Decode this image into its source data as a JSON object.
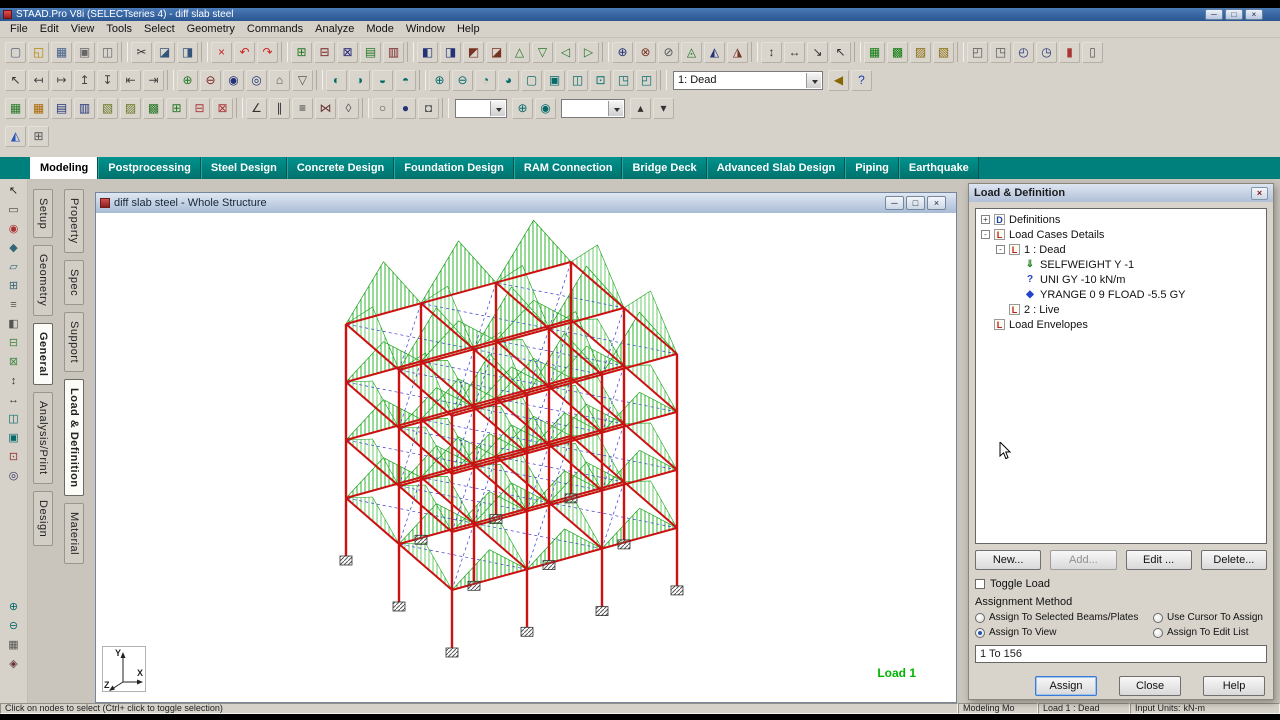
{
  "titlebar": {
    "title": "STAAD.Pro V8i (SELECTseries 4) - diff slab steel",
    "window_buttons": [
      {
        "g": "─"
      },
      {
        "g": "□"
      },
      {
        "g": "×"
      }
    ]
  },
  "menubar": [
    "File",
    "Edit",
    "View",
    "Tools",
    "Select",
    "Geometry",
    "Commands",
    "Analyze",
    "Mode",
    "Window",
    "Help"
  ],
  "toolbars": {
    "load_case_value": "1: Dead",
    "combo2_value": "",
    "combo3_value": "",
    "row1": [
      {
        "g": "▢",
        "c": "#55667a"
      },
      {
        "g": "◱",
        "c": "#b8860b"
      },
      {
        "g": "▦",
        "c": "#445e8c"
      },
      {
        "g": "▣",
        "c": "#666666"
      },
      {
        "g": "◫",
        "c": "#666666"
      },
      {
        "sep": true
      },
      {
        "g": "✂",
        "c": "#333333"
      },
      {
        "g": "◪",
        "c": "#33557a"
      },
      {
        "g": "◨",
        "c": "#33557a"
      },
      {
        "sep": true
      },
      {
        "g": "×",
        "c": "#cc2222"
      },
      {
        "g": "↶",
        "c": "#cc2222"
      },
      {
        "g": "↷",
        "c": "#cc2222"
      },
      {
        "sep": true
      },
      {
        "g": "⊞",
        "c": "#227722"
      },
      {
        "g": "⊟",
        "c": "#772222"
      },
      {
        "g": "⊠",
        "c": "#222277"
      },
      {
        "g": "▤",
        "c": "#227722"
      },
      {
        "g": "▥",
        "c": "#772222"
      },
      {
        "sep": true
      },
      {
        "g": "◧",
        "c": "#223377"
      },
      {
        "g": "◨",
        "c": "#223377"
      },
      {
        "g": "◩",
        "c": "#773322"
      },
      {
        "g": "◪",
        "c": "#773322"
      },
      {
        "g": "△",
        "c": "#227722"
      },
      {
        "g": "▽",
        "c": "#227722"
      },
      {
        "g": "◁",
        "c": "#227722"
      },
      {
        "g": "▷",
        "c": "#227722"
      },
      {
        "sep": true
      },
      {
        "g": "⊕",
        "c": "#223377"
      },
      {
        "g": "⊗",
        "c": "#773322"
      },
      {
        "g": "⊘",
        "c": "#555555"
      },
      {
        "g": "◬",
        "c": "#227722"
      },
      {
        "g": "◭",
        "c": "#223377"
      },
      {
        "g": "◮",
        "c": "#773322"
      },
      {
        "sep": true
      },
      {
        "g": "↕",
        "c": "#333333"
      },
      {
        "g": "↔",
        "c": "#333333"
      },
      {
        "g": "↘",
        "c": "#333333"
      },
      {
        "g": "↖",
        "c": "#333333"
      },
      {
        "sep": true
      },
      {
        "g": "▦",
        "c": "#0a7a0a"
      },
      {
        "g": "▩",
        "c": "#0a7a0a"
      },
      {
        "g": "▨",
        "c": "#8a6a0a"
      },
      {
        "g": "▧",
        "c": "#8a6a0a"
      },
      {
        "sep": true
      },
      {
        "g": "◰",
        "c": "#555555"
      },
      {
        "g": "◳",
        "c": "#555555"
      },
      {
        "g": "◴",
        "c": "#223377"
      },
      {
        "g": "◷",
        "c": "#223377"
      },
      {
        "g": "▮",
        "c": "#aa3333"
      },
      {
        "g": "▯",
        "c": "#555555"
      }
    ],
    "row2a": [
      {
        "g": "↖",
        "c": "#333333"
      },
      {
        "g": "↤",
        "c": "#444444"
      },
      {
        "g": "↦",
        "c": "#444444"
      },
      {
        "g": "↥",
        "c": "#444444"
      },
      {
        "g": "↧",
        "c": "#444444"
      },
      {
        "g": "⇤",
        "c": "#444444"
      },
      {
        "g": "⇥",
        "c": "#444444"
      },
      {
        "sep": true
      },
      {
        "g": "⊕",
        "c": "#227722"
      },
      {
        "g": "⊖",
        "c": "#772222"
      },
      {
        "g": "◉",
        "c": "#223377"
      },
      {
        "g": "◎",
        "c": "#223377"
      },
      {
        "g": "⌂",
        "c": "#555555"
      },
      {
        "g": "▽",
        "c": "#555555"
      },
      {
        "sep": true
      },
      {
        "g": "◐",
        "c": "#066a6a"
      },
      {
        "g": "◑",
        "c": "#066a6a"
      },
      {
        "g": "◒",
        "c": "#066a6a"
      },
      {
        "g": "◓",
        "c": "#066a6a"
      },
      {
        "sep": true
      },
      {
        "g": "⊕",
        "c": "#066a6a"
      },
      {
        "g": "⊖",
        "c": "#066a6a"
      },
      {
        "g": "◔",
        "c": "#066a6a"
      },
      {
        "g": "◕",
        "c": "#066a6a"
      },
      {
        "g": "▢",
        "c": "#066a6a"
      },
      {
        "g": "▣",
        "c": "#066a6a"
      },
      {
        "g": "◫",
        "c": "#066a6a"
      },
      {
        "g": "⊡",
        "c": "#066a6a"
      },
      {
        "g": "◳",
        "c": "#066a6a"
      },
      {
        "g": "◰",
        "c": "#066a6a"
      },
      {
        "sep": true
      }
    ],
    "row2b": [
      {
        "g": "◀",
        "c": "#886600"
      },
      {
        "g": "?",
        "c": "#1a3fae"
      }
    ],
    "row3a": [
      {
        "g": "▦",
        "c": "#227722"
      },
      {
        "g": "▦",
        "c": "#aa6600"
      },
      {
        "g": "▤",
        "c": "#223377"
      },
      {
        "g": "▥",
        "c": "#223377"
      },
      {
        "g": "▧",
        "c": "#667722"
      },
      {
        "g": "▨",
        "c": "#667722"
      },
      {
        "g": "▩",
        "c": "#227722"
      },
      {
        "g": "⊞",
        "c": "#227722"
      },
      {
        "g": "⊟",
        "c": "#aa3333"
      },
      {
        "g": "⊠",
        "c": "#aa3333"
      },
      {
        "sep": true
      },
      {
        "g": "∠",
        "c": "#333333"
      },
      {
        "g": "∥",
        "c": "#333333"
      },
      {
        "g": "≡",
        "c": "#333333"
      },
      {
        "g": "⋈",
        "c": "#663333"
      },
      {
        "g": "◊",
        "c": "#555555"
      },
      {
        "sep": true
      },
      {
        "g": "○",
        "c": "#555555"
      },
      {
        "g": "●",
        "c": "#223377"
      },
      {
        "g": "◘",
        "c": "#555555"
      },
      {
        "sep": true
      }
    ],
    "row3b": [
      {
        "g": "⊕",
        "c": "#066a6a"
      },
      {
        "g": "◉",
        "c": "#066a6a"
      }
    ],
    "row3c": [
      {
        "g": "▴",
        "c": "#333333"
      },
      {
        "g": "▾",
        "c": "#333333"
      }
    ],
    "row4": [
      {
        "g": "◭",
        "c": "#2255bb"
      },
      {
        "g": "⊞",
        "c": "#555555"
      }
    ]
  },
  "mode_tabs": [
    {
      "label": "Modeling",
      "active": true
    },
    {
      "label": "Postprocessing"
    },
    {
      "label": "Steel Design"
    },
    {
      "label": "Concrete Design"
    },
    {
      "label": "Foundation Design"
    },
    {
      "label": "RAM Connection"
    },
    {
      "label": "Bridge Deck"
    },
    {
      "label": "Advanced Slab Design"
    },
    {
      "label": "Piping"
    },
    {
      "label": "Earthquake"
    }
  ],
  "left_strip": {
    "top": [
      {
        "g": "↖",
        "c": "#222222"
      },
      {
        "g": "▭",
        "c": "#444444"
      },
      {
        "g": "◉",
        "c": "#aa3333"
      },
      {
        "g": "◆",
        "c": "#336677"
      },
      {
        "g": "▱",
        "c": "#336677"
      },
      {
        "g": "⊞",
        "c": "#336677"
      },
      {
        "g": "≡",
        "c": "#555555"
      },
      {
        "g": "◧",
        "c": "#555555"
      },
      {
        "g": "⊟",
        "c": "#448844"
      },
      {
        "g": "⊠",
        "c": "#448844"
      },
      {
        "g": "↕",
        "c": "#333333"
      },
      {
        "g": "↔",
        "c": "#333333"
      },
      {
        "g": "◫",
        "c": "#066a6a"
      },
      {
        "g": "▣",
        "c": "#066a6a"
      },
      {
        "g": "⊡",
        "c": "#993333"
      },
      {
        "g": "◎",
        "c": "#333366"
      }
    ],
    "bottom": [
      {
        "g": "⊕",
        "c": "#066a6a"
      },
      {
        "g": "⊖",
        "c": "#066a6a"
      },
      {
        "g": "▦",
        "c": "#555555"
      },
      {
        "g": "◈",
        "c": "#663333"
      }
    ]
  },
  "side_tabs": {
    "col1": [
      {
        "label": "Setup"
      },
      {
        "label": "Geometry"
      },
      {
        "label": "General",
        "active": true
      },
      {
        "label": "Analysis/Print"
      },
      {
        "label": "Design"
      }
    ],
    "col2": [
      {
        "label": "Property"
      },
      {
        "label": "Spec"
      },
      {
        "label": "Support"
      },
      {
        "label": "Load & Definition",
        "active": true
      },
      {
        "label": "Material"
      }
    ]
  },
  "model": {
    "window_title": "diff slab steel - Whole Structure",
    "window_buttons": [
      {
        "g": "─"
      },
      {
        "g": "□"
      },
      {
        "g": "×"
      }
    ],
    "load_label": "Load 1",
    "axis": {
      "x": "X",
      "y": "Y",
      "z": "Z"
    }
  },
  "dialog": {
    "title": "Load & Definition",
    "close_glyph": "×",
    "tree": [
      {
        "indent": 0,
        "expand": "+",
        "icon": "D",
        "icon_color": "#1a3fae",
        "cls": "boxed",
        "label": "Definitions"
      },
      {
        "indent": 0,
        "expand": "-",
        "icon": "L",
        "icon_color": "#c02020",
        "cls": "boxed",
        "label": "Load Cases Details"
      },
      {
        "indent": 1,
        "expand": "-",
        "icon": "L",
        "icon_color": "#c02020",
        "cls": "boxed",
        "label": "1 : Dead"
      },
      {
        "indent": 2,
        "expand": "",
        "icon": "⇓",
        "icon_color": "#1e7e1e",
        "label": "SELFWEIGHT Y -1"
      },
      {
        "indent": 2,
        "expand": "",
        "icon": "?",
        "icon_color": "#2244cc",
        "label": "UNI GY -10 kN/m"
      },
      {
        "indent": 2,
        "expand": "",
        "icon": "◆",
        "icon_color": "#2244cc",
        "label": "YRANGE 0 9 FLOAD -5.5 GY"
      },
      {
        "indent": 1,
        "expand": "",
        "icon": "L",
        "icon_color": "#c02020",
        "cls": "boxed",
        "label": "2 : Live"
      },
      {
        "indent": 0,
        "expand": "",
        "icon": "L",
        "icon_color": "#c02020",
        "cls": "boxed",
        "label": "Load Envelopes"
      }
    ],
    "buttons": [
      {
        "label": "New..."
      },
      {
        "label": "Add...",
        "disabled": true
      },
      {
        "label": "Edit ..."
      },
      {
        "label": "Delete..."
      }
    ],
    "toggle_load_label": "Toggle Load",
    "assignment_method_label": "Assignment Method",
    "radios": [
      {
        "label": "Assign To Selected Beams/Plates"
      },
      {
        "label": "Use Cursor To Assign"
      },
      {
        "label": "Assign To View",
        "checked": true
      },
      {
        "label": "Assign To Edit List"
      }
    ],
    "assign_list_value": "1 To 156",
    "action_buttons": [
      {
        "label": "Assign",
        "focused": true
      },
      {
        "label": "Close"
      },
      {
        "label": "Help"
      }
    ]
  },
  "statusbar": {
    "left": "Click on nodes to select (Ctrl+ click to toggle selection)",
    "mode": "Modeling Mo",
    "load": "Load 1 : Dead",
    "units_label": "Input Units:",
    "units": "kN-m"
  }
}
